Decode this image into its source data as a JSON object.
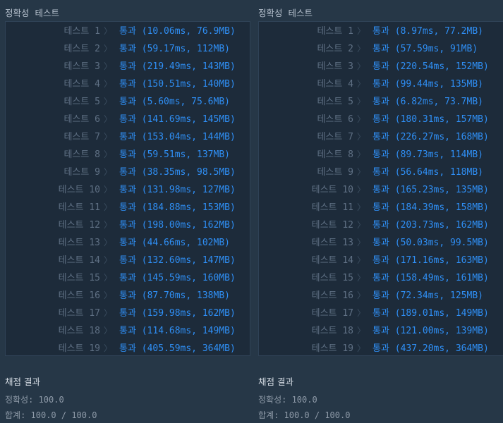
{
  "columns": [
    {
      "title": "정확성  테스트",
      "tests": [
        {
          "name": "테스트 1",
          "result": "통과 (10.06ms, 76.9MB)"
        },
        {
          "name": "테스트 2",
          "result": "통과 (59.17ms, 112MB)"
        },
        {
          "name": "테스트 3",
          "result": "통과 (219.49ms, 143MB)"
        },
        {
          "name": "테스트 4",
          "result": "통과 (150.51ms, 140MB)"
        },
        {
          "name": "테스트 5",
          "result": "통과 (5.60ms, 75.6MB)"
        },
        {
          "name": "테스트 6",
          "result": "통과 (141.69ms, 145MB)"
        },
        {
          "name": "테스트 7",
          "result": "통과 (153.04ms, 144MB)"
        },
        {
          "name": "테스트 8",
          "result": "통과 (59.51ms, 137MB)"
        },
        {
          "name": "테스트 9",
          "result": "통과 (38.35ms, 98.5MB)"
        },
        {
          "name": "테스트 10",
          "result": "통과 (131.98ms, 127MB)"
        },
        {
          "name": "테스트 11",
          "result": "통과 (184.88ms, 153MB)"
        },
        {
          "name": "테스트 12",
          "result": "통과 (198.00ms, 162MB)"
        },
        {
          "name": "테스트 13",
          "result": "통과 (44.66ms, 102MB)"
        },
        {
          "name": "테스트 14",
          "result": "통과 (132.60ms, 147MB)"
        },
        {
          "name": "테스트 15",
          "result": "통과 (145.59ms, 160MB)"
        },
        {
          "name": "테스트 16",
          "result": "통과 (87.70ms, 138MB)"
        },
        {
          "name": "테스트 17",
          "result": "통과 (159.98ms, 162MB)"
        },
        {
          "name": "테스트 18",
          "result": "통과 (114.68ms, 149MB)"
        },
        {
          "name": "테스트 19",
          "result": "통과 (405.59ms, 364MB)"
        }
      ],
      "summary": {
        "title": "채점 결과",
        "accuracy": "정확성: 100.0",
        "total": "합계: 100.0 / 100.0"
      }
    },
    {
      "title": "정확성  테스트",
      "tests": [
        {
          "name": "테스트 1",
          "result": "통과 (8.97ms, 77.2MB)"
        },
        {
          "name": "테스트 2",
          "result": "통과 (57.59ms, 91MB)"
        },
        {
          "name": "테스트 3",
          "result": "통과 (220.54ms, 152MB)"
        },
        {
          "name": "테스트 4",
          "result": "통과 (99.44ms, 135MB)"
        },
        {
          "name": "테스트 5",
          "result": "통과 (6.82ms, 73.7MB)"
        },
        {
          "name": "테스트 6",
          "result": "통과 (180.31ms, 157MB)"
        },
        {
          "name": "테스트 7",
          "result": "통과 (226.27ms, 168MB)"
        },
        {
          "name": "테스트 8",
          "result": "통과 (89.73ms, 114MB)"
        },
        {
          "name": "테스트 9",
          "result": "통과 (56.64ms, 118MB)"
        },
        {
          "name": "테스트 10",
          "result": "통과 (165.23ms, 135MB)"
        },
        {
          "name": "테스트 11",
          "result": "통과 (184.39ms, 158MB)"
        },
        {
          "name": "테스트 12",
          "result": "통과 (203.73ms, 162MB)"
        },
        {
          "name": "테스트 13",
          "result": "통과 (50.03ms, 99.5MB)"
        },
        {
          "name": "테스트 14",
          "result": "통과 (171.16ms, 163MB)"
        },
        {
          "name": "테스트 15",
          "result": "통과 (158.49ms, 161MB)"
        },
        {
          "name": "테스트 16",
          "result": "통과 (72.34ms, 125MB)"
        },
        {
          "name": "테스트 17",
          "result": "통과 (189.01ms, 149MB)"
        },
        {
          "name": "테스트 18",
          "result": "통과 (121.00ms, 139MB)"
        },
        {
          "name": "테스트 19",
          "result": "통과 (437.20ms, 364MB)"
        }
      ],
      "summary": {
        "title": "채점 결과",
        "accuracy": "정확성: 100.0",
        "total": "합계: 100.0 / 100.0"
      }
    }
  ],
  "colors": {
    "background": "#263747",
    "panel": "#1d2b3a",
    "pass": "#2f8ff5",
    "test_name": "#5f7084"
  },
  "icons": {
    "row_separator": "chevron-right-icon"
  }
}
